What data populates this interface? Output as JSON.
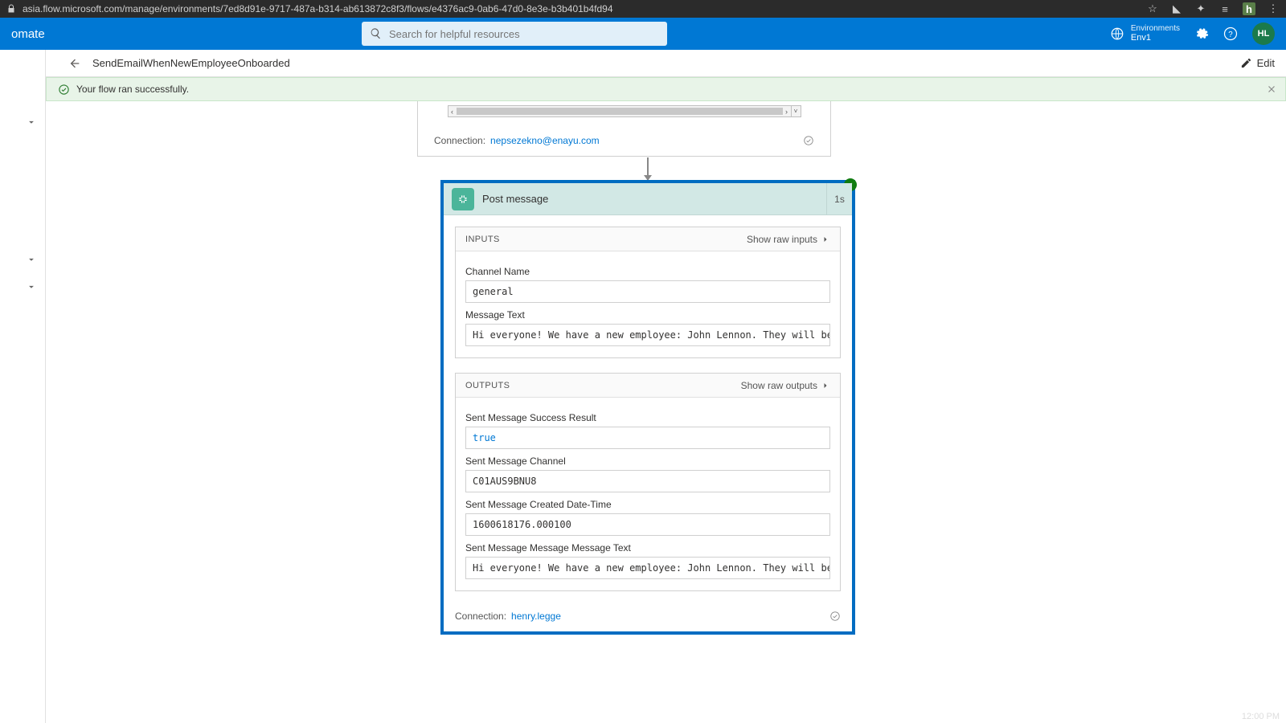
{
  "browser": {
    "url": "asia.flow.microsoft.com/manage/environments/7ed8d91e-9717-487a-b314-ab613872c8f3/flows/e4376ac9-0ab6-47d0-8e3e-b3b401b4fd94",
    "ext_badge": "h"
  },
  "app": {
    "brand": "omate",
    "search_placeholder": "Search for helpful resources",
    "env_label": "Environments",
    "env_name": "Env1",
    "avatar": "HL"
  },
  "titlebar": {
    "flow_name": "SendEmailWhenNewEmployeeOnboarded",
    "edit": "Edit"
  },
  "banner": {
    "text": "Your flow ran successfully."
  },
  "prev_card": {
    "connection_label": "Connection:",
    "connection_value": "nepsezekno@enayu.com"
  },
  "card": {
    "title": "Post message",
    "duration": "1s",
    "inputs": {
      "heading": "INPUTS",
      "show_raw": "Show raw inputs",
      "fields": {
        "channel_label": "Channel Name",
        "channel_value": "general",
        "message_label": "Message Text",
        "message_value": "Hi everyone! We have a new employee: John Lennon. They will be repo"
      }
    },
    "outputs": {
      "heading": "OUTPUTS",
      "show_raw": "Show raw outputs",
      "fields": {
        "success_label": "Sent Message Success Result",
        "success_value": "true",
        "chan_label": "Sent Message Channel",
        "chan_value": "C01AUS9BNU8",
        "dt_label": "Sent Message Created Date-Time",
        "dt_value": "1600618176.000100",
        "mt_label": "Sent Message Message Message Text",
        "mt_value": "Hi everyone! We have a new employee: John Lennon. They will be repo"
      }
    },
    "connection_label": "Connection:",
    "connection_value": "henry.legge"
  },
  "clock": "12:00 PM"
}
